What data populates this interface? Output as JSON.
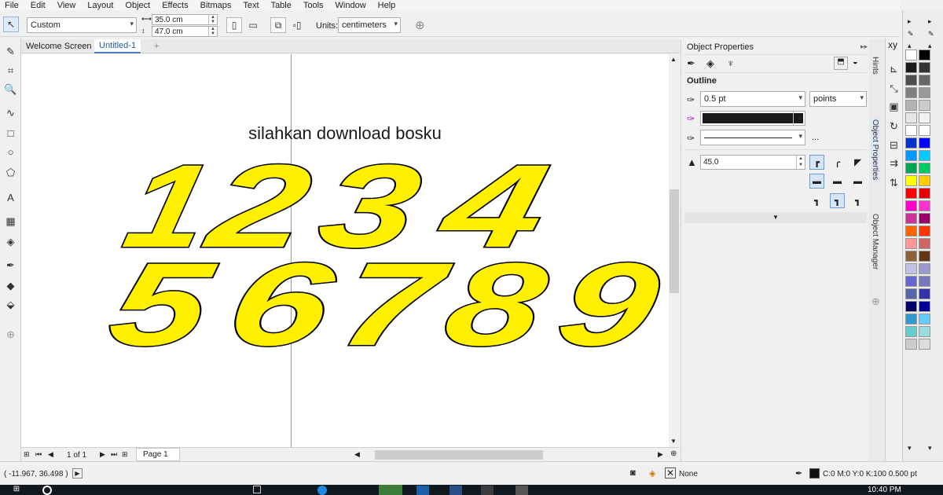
{
  "menu": [
    "File",
    "Edit",
    "View",
    "Layout",
    "Object",
    "Effects",
    "Bitmaps",
    "Text",
    "Table",
    "Tools",
    "Window",
    "Help"
  ],
  "propbar": {
    "preset": "Custom",
    "width": "35.0 cm",
    "height": "47.0 cm",
    "units_label": "Units:",
    "units_value": "centimeters"
  },
  "tabs": {
    "welcome": "Welcome Screen",
    "doc": "Untitled-1",
    "add": "+"
  },
  "canvas": {
    "text": "silahkan download bosku",
    "row1": [
      "1",
      "2",
      "3",
      "4"
    ],
    "row2": [
      "5",
      "6",
      "7",
      "8",
      "9"
    ],
    "fill_color": "#ffef00",
    "outline_color": "#000000"
  },
  "pagenav": {
    "page_count": "1 of 1",
    "page_tab": "Page 1"
  },
  "properties": {
    "title": "Object Properties",
    "section": "Outline",
    "width_value": "0.5 pt",
    "width_units": "points",
    "color": "#1a1a1a",
    "more": "...",
    "miter": "45.0"
  },
  "dock_tabs": {
    "hints": "Hints",
    "props": "Object Properties",
    "manager": "Object Manager"
  },
  "right_strip": {
    "xy": "xy"
  },
  "status": {
    "coords": "( -11.967, 36.498 )",
    "fill_none": "None",
    "outline_info": "C:0 M:0 Y:0 K:100  0.500 pt"
  },
  "taskbar": {
    "time": "10:40 PM"
  },
  "palette_colors": [
    [
      "#ffffff",
      "#000000"
    ],
    [
      "#1a1a1a",
      "#333333"
    ],
    [
      "#4d4d4d",
      "#666666"
    ],
    [
      "#808080",
      "#999999"
    ],
    [
      "#b3b3b3",
      "#cccccc"
    ],
    [
      "#e6e6e6",
      "#f2f2f2"
    ],
    [
      "#ffffff",
      "#ffffff"
    ],
    [
      "#0033cc",
      "#0000ff"
    ],
    [
      "#0099ff",
      "#00ccff"
    ],
    [
      "#00a651",
      "#00cc66"
    ],
    [
      "#ffff00",
      "#ffcc00"
    ],
    [
      "#ff0000",
      "#e60000"
    ],
    [
      "#ff00cc",
      "#ff33cc"
    ],
    [
      "#cc3399",
      "#990066"
    ],
    [
      "#ff6600",
      "#ff3300"
    ],
    [
      "#ff9999",
      "#cc6666"
    ],
    [
      "#8c6239",
      "#603813"
    ],
    [
      "#c2c2e8",
      "#9999cc"
    ],
    [
      "#6666cc",
      "#7777bb"
    ],
    [
      "#5566aa",
      "#3333aa"
    ],
    [
      "#000066",
      "#000099"
    ],
    [
      "#3399cc",
      "#66ccff"
    ],
    [
      "#66cccc",
      "#99dddd"
    ],
    [
      "#cccccc",
      "#dddddd"
    ]
  ]
}
